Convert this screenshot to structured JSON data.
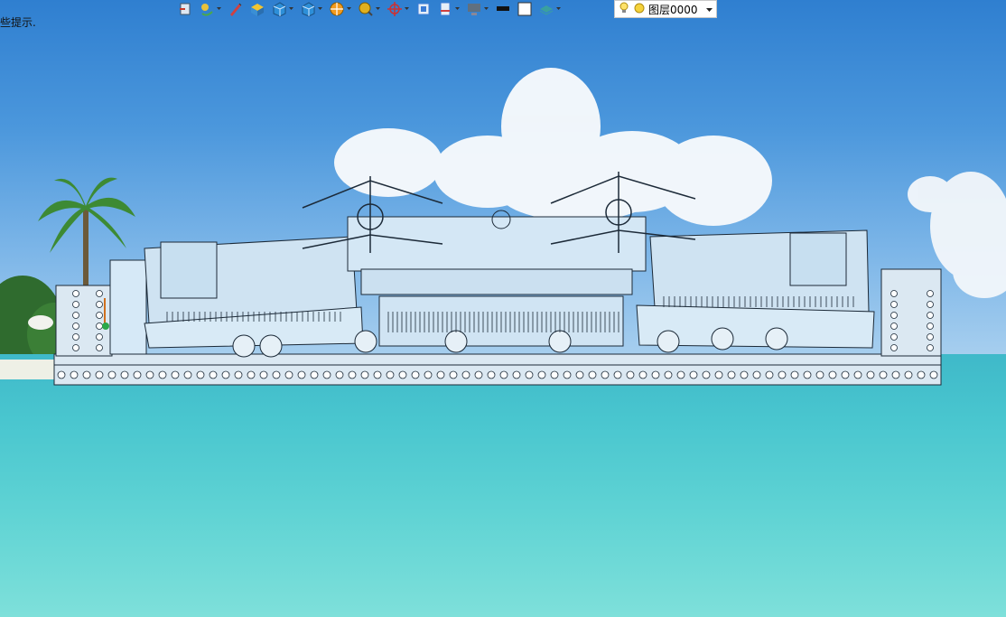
{
  "hint_text": "些提示.",
  "toolbar": {
    "buttons": [
      {
        "name": "undo-view-icon",
        "color": "#c83a2a"
      },
      {
        "name": "orbit-icon",
        "color": "#4aa84a",
        "dropdown": true
      },
      {
        "name": "pencil-icon",
        "color": "#d04040"
      },
      {
        "name": "box-face-icon",
        "color": "#f2c531"
      },
      {
        "name": "cube-view-icon",
        "color": "#2d8fd8",
        "dropdown": true
      },
      {
        "name": "multi-cube-icon",
        "color": "#2d8fd8",
        "dropdown": true
      },
      {
        "name": "sun-shading-icon",
        "color": "#f29a1d",
        "dropdown": true
      },
      {
        "name": "zoom-icon",
        "color": "#e0b020",
        "dropdown": true
      },
      {
        "name": "crosshair-icon",
        "color": "#d03030",
        "dropdown": true
      },
      {
        "name": "view-frame-icon",
        "color": "#3a7bd5"
      },
      {
        "name": "section-icon",
        "color": "#3a7bd5",
        "dropdown": true
      },
      {
        "name": "display-icon",
        "color": "#607080",
        "dropdown": true
      },
      {
        "name": "black-rect-icon",
        "color": "#111111"
      },
      {
        "name": "white-rect-icon",
        "color": "#ffffff"
      },
      {
        "name": "layers-stack-icon",
        "color": "#3aa0a0",
        "dropdown": true
      }
    ]
  },
  "layer": {
    "label": "图层0000",
    "icons": [
      "lightbulb-icon",
      "layer-sun-icon",
      "chevron-down-icon"
    ]
  },
  "colors": {
    "model_fill": "#d6e9f7",
    "model_line": "#1c2a38",
    "sky_top": "#2f7fd0",
    "sea": "#4ec4cf"
  }
}
